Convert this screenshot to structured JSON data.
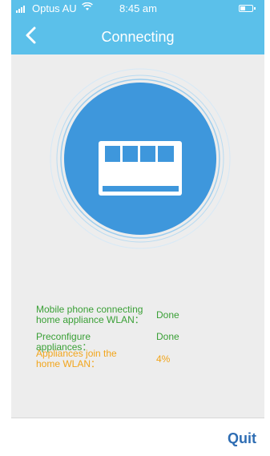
{
  "status_bar": {
    "carrier": "Optus AU",
    "wifi_icon": "wifi-icon",
    "time": "8:45 am",
    "battery_level": 0.45
  },
  "nav": {
    "back_icon": "chevron-left-icon",
    "title": "Connecting"
  },
  "illustration": {
    "icon": "air-conditioner-icon",
    "circle_color": "#3e97dc",
    "ring_color": "#9ccdee"
  },
  "steps": [
    {
      "label_line1": "Mobile phone connecting",
      "label_line2": "home appliance WLAN：",
      "value": "Done",
      "state": "done"
    },
    {
      "label_line1": "Preconfigure appliances：",
      "label_line2": "",
      "value": "Done",
      "state": "done"
    },
    {
      "label_line1": "Appliances join the",
      "label_line2": "home WLAN：",
      "value": "4%",
      "state": "progress"
    }
  ],
  "colors": {
    "header": "#5bc0ea",
    "done": "#3aa036",
    "progress": "#f2a51b",
    "quit": "#2e6db3"
  },
  "footer": {
    "quit_label": "Quit"
  }
}
